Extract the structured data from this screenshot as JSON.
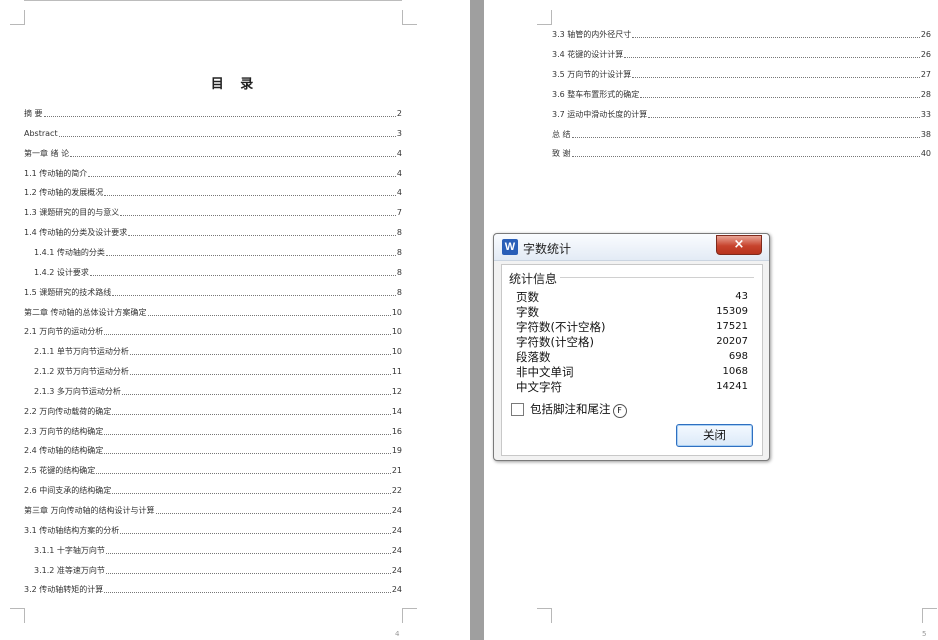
{
  "left_page": {
    "title": "目  录",
    "page_number": "4",
    "entries": [
      {
        "title": "摘  要",
        "page": "2"
      },
      {
        "title": "Abstract",
        "page": "3"
      },
      {
        "title": "第一章  绪    论",
        "page": "4"
      },
      {
        "title": "1.1 传动轴的简介",
        "page": "4"
      },
      {
        "title": "1.2 传动轴的发展概况",
        "page": "4"
      },
      {
        "title": "1.3 课题研究的目的与意义",
        "page": "7"
      },
      {
        "title": "1.4 传动轴的分类及设计要求",
        "page": "8"
      },
      {
        "title": "1.4.1 传动轴的分类",
        "page": "8"
      },
      {
        "title": "1.4.2 设计要求",
        "page": "8"
      },
      {
        "title": "1.5 课题研究的技术路线",
        "page": "8"
      },
      {
        "title": "第二章   传动轴的总体设计方案确定",
        "page": "10"
      },
      {
        "title": "2.1 万向节的运动分析",
        "page": "10"
      },
      {
        "title": "2.1.1 单节万向节运动分析",
        "page": "10"
      },
      {
        "title": "2.1.2 双节万向节运动分析",
        "page": "11"
      },
      {
        "title": "2.1.3 多万向节运动分析",
        "page": "12"
      },
      {
        "title": "2.2 万向传动载荷的确定",
        "page": "14"
      },
      {
        "title": "2.3 万向节的结构确定",
        "page": "16"
      },
      {
        "title": "2.4 传动轴的结构确定",
        "page": "19"
      },
      {
        "title": "2.5 花键的结构确定",
        "page": "21"
      },
      {
        "title": "2.6   中间支承的结构确定",
        "page": "22"
      },
      {
        "title": "第三章   万向传动轴的结构设计与计算",
        "page": "24"
      },
      {
        "title": "3.1 传动轴结构方案的分析",
        "page": "24"
      },
      {
        "title": "3.1.1 十字轴万向节",
        "page": "24"
      },
      {
        "title": "3.1.2 准等速万向节",
        "page": "24"
      },
      {
        "title": "3.2 传动轴转矩的计算",
        "page": "24"
      }
    ]
  },
  "right_page": {
    "page_number": "5",
    "entries": [
      {
        "title": "3.3 轴管的内外径尺寸",
        "page": "26"
      },
      {
        "title": "3.4 花键的设计计算",
        "page": "26"
      },
      {
        "title": "3.5 万向节的计设计算",
        "page": "27"
      },
      {
        "title": "3.6 整车布置形式的确定",
        "page": "28"
      },
      {
        "title": "3.7 运动中滑动长度的计算",
        "page": "33"
      },
      {
        "title": "总    结",
        "page": "38"
      },
      {
        "title": "致    谢",
        "page": "40"
      }
    ]
  },
  "dialog": {
    "title": "字数统计",
    "app_icon_letter": "W",
    "close_x": "×",
    "group_label": "统计信息",
    "stats": [
      {
        "label": "页数",
        "value": "43"
      },
      {
        "label": "字数",
        "value": "15309"
      },
      {
        "label": "字符数(不计空格)",
        "value": "17521"
      },
      {
        "label": "字符数(计空格)",
        "value": "20207"
      },
      {
        "label": "段落数",
        "value": "698"
      },
      {
        "label": "非中文单词",
        "value": "1068"
      },
      {
        "label": "中文字符",
        "value": "14241"
      }
    ],
    "include_label": "包括脚注和尾注",
    "include_hotkey": "F",
    "include_checked": false,
    "close_button": "关闭"
  }
}
